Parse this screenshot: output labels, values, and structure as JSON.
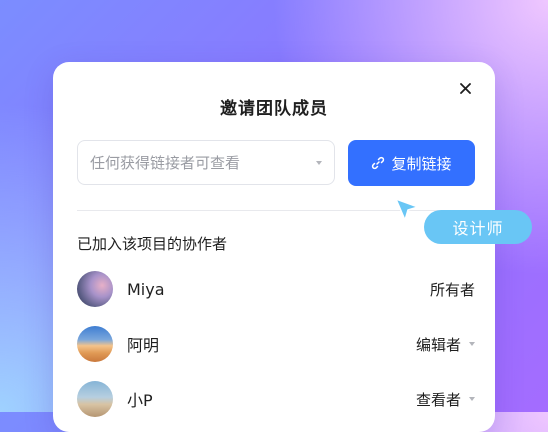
{
  "dialog": {
    "title": "邀请团队成员",
    "permission_select": {
      "value": "任何获得链接者可查看"
    },
    "copy_button": {
      "label": "复制链接",
      "icon": "link-icon"
    },
    "collaborators_title": "已加入该项目的协作者",
    "members": [
      {
        "name": "Miya",
        "role": "所有者",
        "has_dropdown": false
      },
      {
        "name": "阿明",
        "role": "编辑者",
        "has_dropdown": true
      },
      {
        "name": "小P",
        "role": "查看者",
        "has_dropdown": true
      }
    ]
  },
  "cursor_badge": {
    "label": "设计师"
  },
  "colors": {
    "accent": "#3370ff",
    "badge": "#69c6f5"
  }
}
